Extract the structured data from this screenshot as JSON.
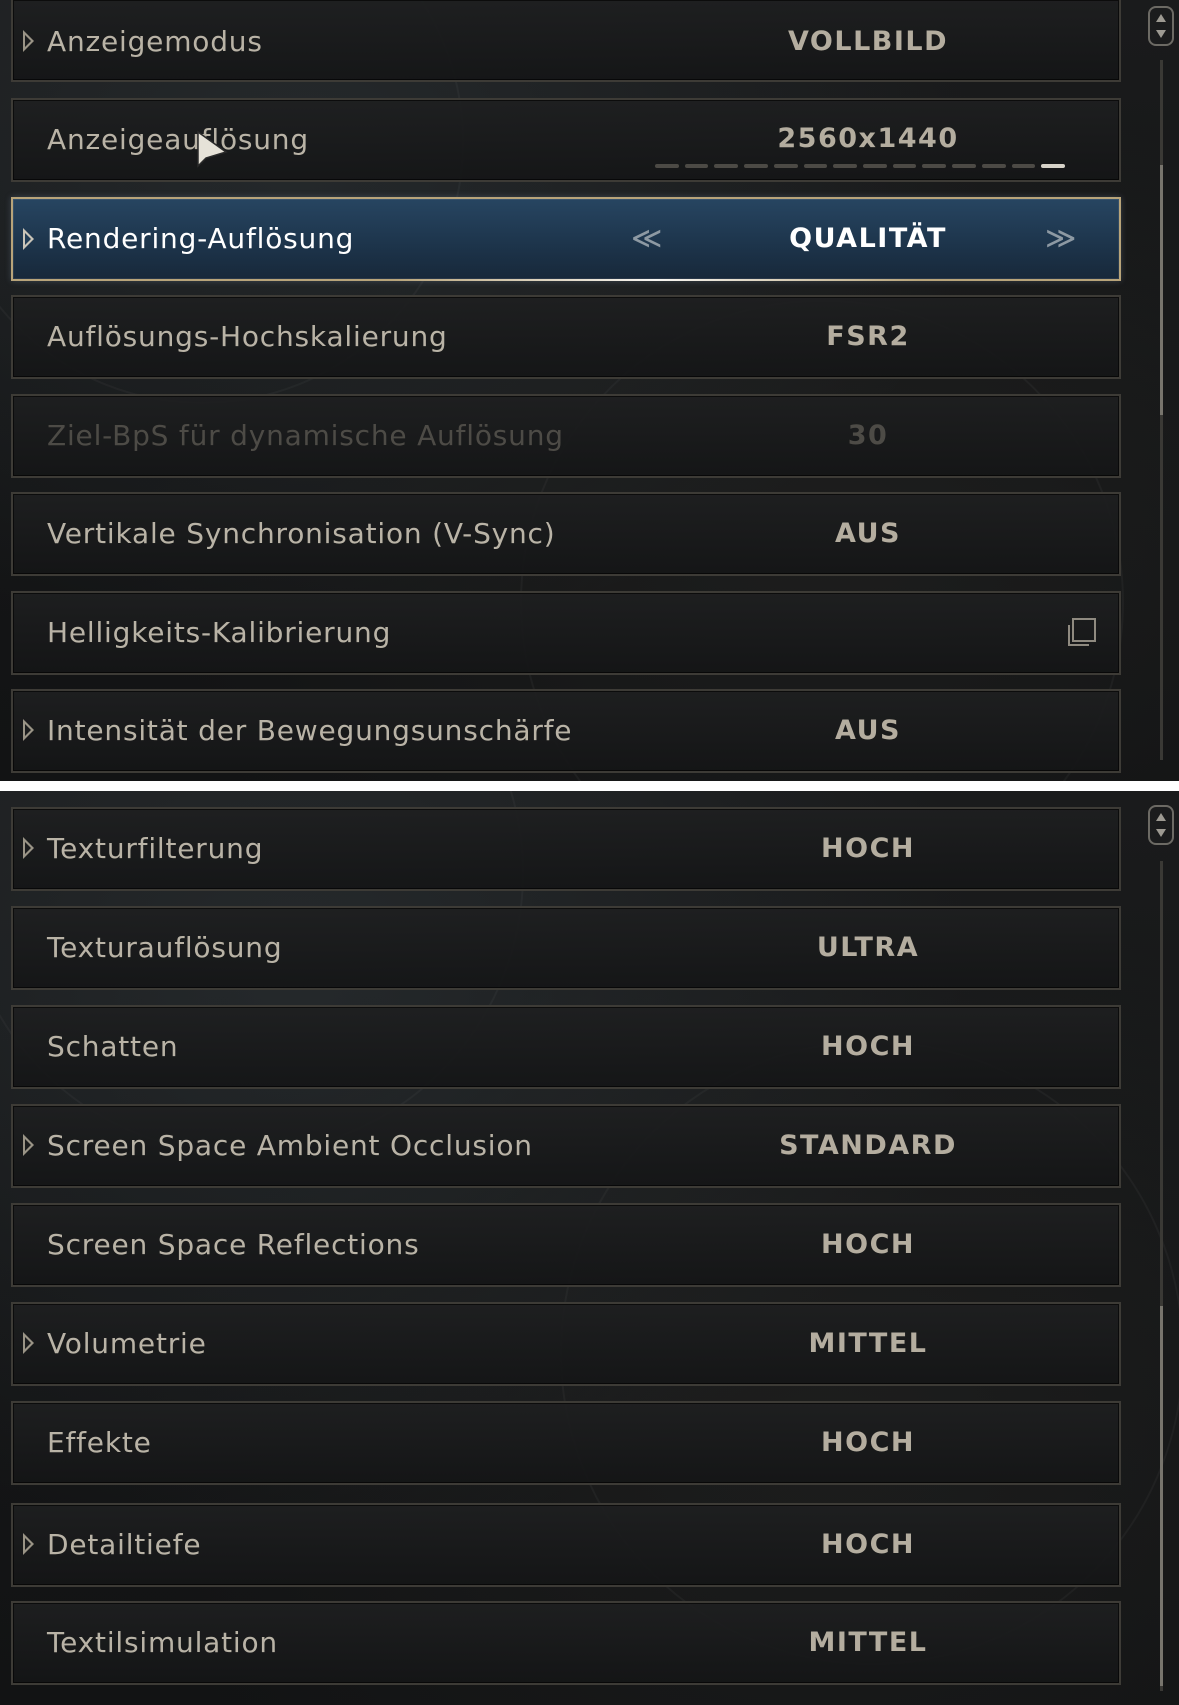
{
  "top_panel": {
    "rows": [
      {
        "label": "Anzeigemodus",
        "value": "VOLLBILD",
        "expandable": true,
        "state": "normal"
      },
      {
        "label": "Anzeigeauflösung",
        "value": "2560x1440",
        "expandable": false,
        "state": "normal",
        "slider_segments": 14,
        "slider_selected_index": 13
      },
      {
        "label": "Rendering-Auflösung",
        "value": "QUALITÄT",
        "expandable": true,
        "state": "selected",
        "prev_glyph": "≪",
        "next_glyph": "≫"
      },
      {
        "label": "Auflösungs-Hochskalierung",
        "value": "FSR2",
        "expandable": false,
        "state": "normal"
      },
      {
        "label": "Ziel-BpS für dynamische Auflösung",
        "value": "30",
        "expandable": false,
        "state": "disabled"
      },
      {
        "label": "Vertikale Synchronisation (V-Sync)",
        "value": "AUS",
        "expandable": false,
        "state": "normal"
      },
      {
        "label": "Helligkeits-Kalibrierung",
        "value": "",
        "expandable": false,
        "state": "normal",
        "icon": "open-external-icon"
      },
      {
        "label": "Intensität der Bewegungsunschärfe",
        "value": "AUS",
        "expandable": true,
        "state": "normal"
      }
    ]
  },
  "bottom_panel": {
    "rows": [
      {
        "label": "Texturfilterung",
        "value": "HOCH",
        "expandable": true
      },
      {
        "label": "Texturauflösung",
        "value": "ULTRA",
        "expandable": false
      },
      {
        "label": "Schatten",
        "value": "HOCH",
        "expandable": false
      },
      {
        "label": "Screen Space Ambient Occlusion",
        "value": "STANDARD",
        "expandable": true
      },
      {
        "label": "Screen Space Reflections",
        "value": "HOCH",
        "expandable": false
      },
      {
        "label": "Volumetrie",
        "value": "MITTEL",
        "expandable": true
      },
      {
        "label": "Effekte",
        "value": "HOCH",
        "expandable": false
      },
      {
        "label": "Detailtiefe",
        "value": "HOCH",
        "expandable": true
      },
      {
        "label": "Textilsimulation",
        "value": "MITTEL",
        "expandable": false
      }
    ]
  },
  "colors": {
    "selected_border": "#b8a47a",
    "selected_fill": "#1f3850",
    "row_border": "#3d3b36",
    "text": "#b9b3a6"
  }
}
